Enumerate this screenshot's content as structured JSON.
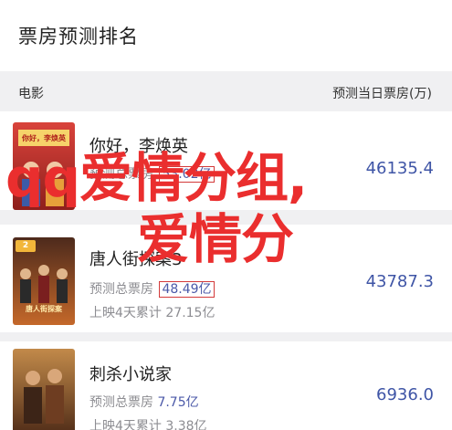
{
  "header": {
    "title": "票房预测排名"
  },
  "columns": {
    "left": "电影",
    "right": "预测当日票房(万)"
  },
  "movies": [
    {
      "name": "你好，李焕英",
      "predicted_label": "预测总票房",
      "predicted_value": "53.02亿",
      "days_label": "上映4天累计",
      "days_value": "",
      "daily": "46135.4",
      "poster_badge": "",
      "poster_title": "你好，李焕英"
    },
    {
      "name": "唐人街探案3",
      "predicted_label": "预测总票房",
      "predicted_value": "48.49亿",
      "days_label": "上映4天累计",
      "days_value": "27.15亿",
      "daily": "43787.3",
      "poster_badge": "2",
      "poster_title": "唐人街探案"
    },
    {
      "name": "刺杀小说家",
      "predicted_label": "预测总票房",
      "predicted_value": "7.75亿",
      "days_label": "上映4天累计",
      "days_value": "3.38亿",
      "daily": "6936.0",
      "poster_badge": "",
      "poster_title": ""
    }
  ],
  "overlay": {
    "line1": "qq爱情分组,",
    "line2": "爱情分"
  },
  "colors": {
    "accent_blue": "#3f55a6",
    "overlay_red": "#ea2e2e",
    "highlight_box": "#d33a3a",
    "badge_gold": "#f2b63a"
  }
}
